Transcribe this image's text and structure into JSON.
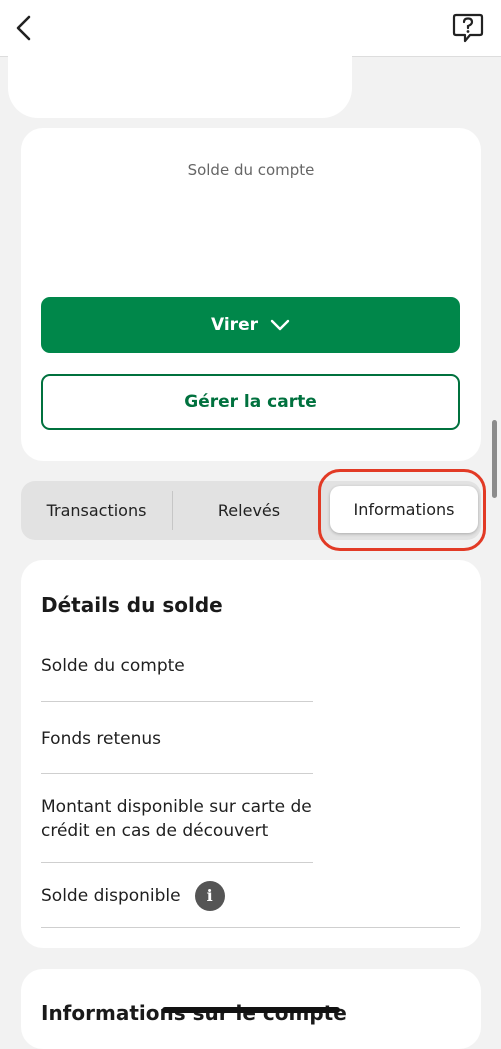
{
  "header": {
    "back_icon": "chevron-left-icon",
    "help_icon": "chat-question-icon"
  },
  "account": {
    "balance_label": "Solde du compte",
    "transfer_label": "Virer",
    "manage_card_label": "Gérer la carte"
  },
  "tabs": {
    "transactions": "Transactions",
    "releves": "Relevés",
    "informations": "Informations",
    "selected": "Informations"
  },
  "details": {
    "title": "Détails du solde",
    "rows": [
      {
        "label": "Solde du compte"
      },
      {
        "label": "Fonds retenus"
      },
      {
        "label": "Montant disponible sur carte de crédit en cas de découvert"
      },
      {
        "label": "Solde disponible"
      }
    ],
    "info_icon_glyph": "i"
  },
  "account_info": {
    "title": "Informations sur le compte"
  },
  "colors": {
    "primary_green": "#00874a",
    "outline_green": "#00713e",
    "highlight_red": "#e23a25"
  }
}
